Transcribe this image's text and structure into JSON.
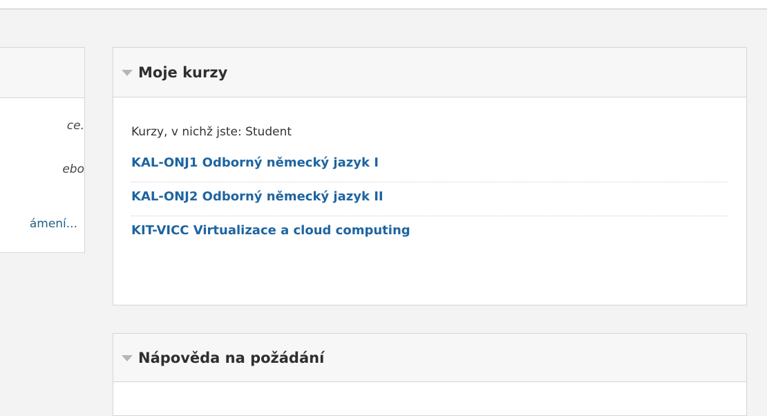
{
  "left_panel": {
    "line1": "ce.",
    "line2": "ebo",
    "line3": "ámení..."
  },
  "my_courses": {
    "title": "Moje kurzy",
    "role_line": "Kurzy, v nichž jste: Student",
    "courses": [
      {
        "label": "KAL-ONJ1 Odborný německý jazyk I"
      },
      {
        "label": "KAL-ONJ2 Odborný německý jazyk II"
      },
      {
        "label": "KIT-VICC Virtualizace a cloud computing"
      }
    ],
    "link_color": "#1e64a0"
  },
  "help_block": {
    "title": "Nápověda na požádání"
  }
}
